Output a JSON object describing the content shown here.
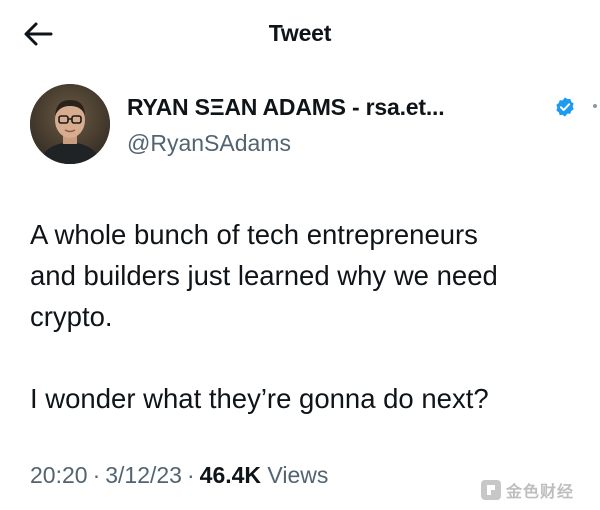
{
  "header": {
    "title": "Tweet",
    "back_icon": "arrow-left-icon"
  },
  "author": {
    "display_name": "RYAN SΞAN ADAMS - rsa.et...",
    "handle": "@RyanSAdams",
    "verified_icon": "verified-badge-icon",
    "verified_color": "#1d9bf0",
    "more_icon": "more-horizontal-icon"
  },
  "tweet": {
    "line1": "A whole bunch of tech entrepreneurs",
    "line2": "and builders just learned why we need",
    "line3": "crypto.",
    "line4": "I wonder what they’re gonna do next?"
  },
  "meta": {
    "time": "20:20",
    "date": "3/12/23",
    "views_count": "46.4K",
    "views_label": "Views"
  },
  "watermark": {
    "text": "金色财经",
    "icon": "jinse-logo-icon"
  }
}
